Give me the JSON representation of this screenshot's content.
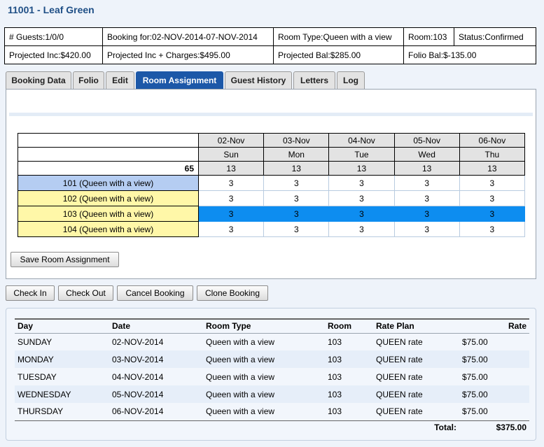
{
  "title": "11001 - Leaf Green",
  "summary": {
    "guests": "# Guests:1/0/0",
    "booking_for": "Booking for:02-NOV-2014-07-NOV-2014",
    "room_type": "Room Type:Queen with a view",
    "room": "Room:103",
    "status": "Status:Confirmed",
    "projected_inc": "Projected Inc:$420.00",
    "projected_inc_charges": "Projected Inc + Charges:$495.00",
    "projected_bal": "Projected Bal:$285.00",
    "folio_bal": "Folio Bal:$-135.00"
  },
  "tabs": [
    "Booking Data",
    "Folio",
    "Edit",
    "Room Assignment",
    "Guest History",
    "Letters",
    "Log"
  ],
  "active_tab": "Room Assignment",
  "assignment": {
    "dates": [
      "02-Nov",
      "03-Nov",
      "04-Nov",
      "05-Nov",
      "06-Nov"
    ],
    "days": [
      "Sun",
      "Mon",
      "Tue",
      "Wed",
      "Thu"
    ],
    "total_label": "65",
    "totals": [
      "13",
      "13",
      "13",
      "13",
      "13"
    ],
    "rooms": [
      {
        "name": "101 (Queen with a view)",
        "values": [
          "3",
          "3",
          "3",
          "3",
          "3"
        ]
      },
      {
        "name": "102 (Queen with a view)",
        "values": [
          "3",
          "3",
          "3",
          "3",
          "3"
        ]
      },
      {
        "name": "103 (Queen with a view)",
        "values": [
          "3",
          "3",
          "3",
          "3",
          "3"
        ]
      },
      {
        "name": "104 (Queen with a view)",
        "values": [
          "3",
          "3",
          "3",
          "3",
          "3"
        ]
      }
    ],
    "save_label": "Save Room Assignment"
  },
  "actions": {
    "check_in": "Check In",
    "check_out": "Check Out",
    "cancel_booking": "Cancel Booking",
    "clone_booking": "Clone Booking"
  },
  "rates": {
    "headers": [
      "Day",
      "Date",
      "Room Type",
      "Room",
      "Rate Plan",
      "Rate"
    ],
    "rows": [
      [
        "SUNDAY",
        "02-NOV-2014",
        "Queen with a view",
        "103",
        "QUEEN rate",
        "$75.00"
      ],
      [
        "MONDAY",
        "03-NOV-2014",
        "Queen with a view",
        "103",
        "QUEEN rate",
        "$75.00"
      ],
      [
        "TUESDAY",
        "04-NOV-2014",
        "Queen with a view",
        "103",
        "QUEEN rate",
        "$75.00"
      ],
      [
        "WEDNESDAY",
        "05-NOV-2014",
        "Queen with a view",
        "103",
        "QUEEN rate",
        "$75.00"
      ],
      [
        "THURSDAY",
        "06-NOV-2014",
        "Queen with a view",
        "103",
        "QUEEN rate",
        "$75.00"
      ]
    ],
    "total_label": "Total:",
    "total_value": "$375.00"
  },
  "colors": {
    "title": "#1f4f86",
    "active_tab": "#1c58a8",
    "selected_row": "#0d8df0",
    "room_selected": "#b5cdf2",
    "room_default": "#fff7a8"
  }
}
